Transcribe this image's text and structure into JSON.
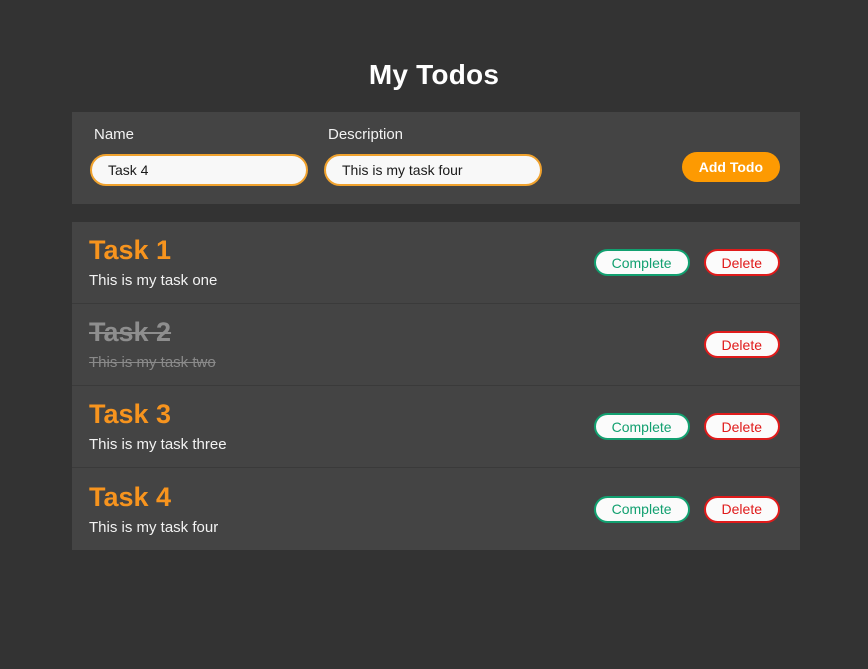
{
  "app": {
    "title": "My Todos",
    "background_color": "#333333",
    "panel_color": "#444444",
    "accent_color": "#f7941e"
  },
  "form": {
    "name_label": "Name",
    "name_value": "Task 4",
    "name_placeholder": "Name",
    "description_label": "Description",
    "description_value": "This is my task four",
    "description_placeholder": "Description",
    "add_button_label": "Add Todo"
  },
  "buttons": {
    "complete_label": "Complete",
    "delete_label": "Delete",
    "complete_color": "#12a070",
    "delete_color": "#e01b1b"
  },
  "todos": [
    {
      "title": "Task 1",
      "description": "This is my task one",
      "completed": false
    },
    {
      "title": "Task 2",
      "description": "This is my task two",
      "completed": true
    },
    {
      "title": "Task 3",
      "description": "This is my task three",
      "completed": false
    },
    {
      "title": "Task 4",
      "description": "This is my task four",
      "completed": false
    }
  ]
}
